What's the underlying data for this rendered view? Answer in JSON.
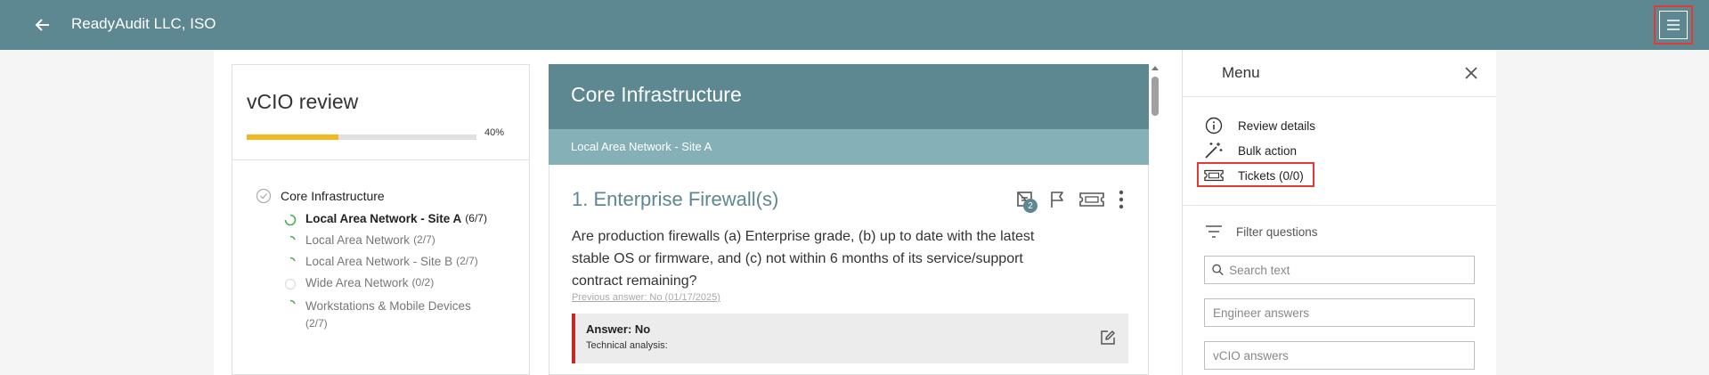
{
  "header": {
    "title": "ReadyAudit LLC, ISO",
    "back_icon": "arrow-left-icon",
    "menu_icon": "hamburger-menu-icon",
    "bar_color": "#5d8791"
  },
  "review": {
    "title": "vCIO review",
    "progress_percent": 40,
    "progress_label": "40%",
    "progress_color": "#f3b81f",
    "section": {
      "label": "Core Infrastructure",
      "items": [
        {
          "label": "Local Area Network - Site A",
          "count": "(6/7)",
          "active": true
        },
        {
          "label": "Local Area Network",
          "count": "(2/7)",
          "active": false
        },
        {
          "label": "Local Area Network - Site B",
          "count": "(2/7)",
          "active": false
        },
        {
          "label": "Wide Area Network",
          "count": "(0/2)",
          "active": false
        },
        {
          "label": "Workstations & Mobile Devices",
          "count": "(2/7)",
          "active": false
        }
      ]
    }
  },
  "main": {
    "category_title": "Core Infrastructure",
    "subcategory_title": "Local Area Network - Site A",
    "question": {
      "title": "1. Enterprise Firewall(s)",
      "text": "Are production firewalls (a) Enterprise grade, (b) up to date with the latest stable OS or firmware, and (c) not within 6 months of its service/support contract remaining?",
      "previous_answer": "Previous answer: No (01/17/2025)",
      "notes_badge": "2",
      "answer_label": "Answer: No",
      "technical_label": "Technical analysis:",
      "answer_color": "#c62828"
    }
  },
  "menu": {
    "title": "Menu",
    "items": [
      {
        "label": "Review details",
        "icon": "info-icon"
      },
      {
        "label": "Bulk action",
        "icon": "magic-wand-icon"
      },
      {
        "label": "Tickets (0/0)",
        "icon": "ticket-icon"
      }
    ],
    "filter_label": "Filter questions",
    "search_placeholder": "Search text",
    "engineer_placeholder": "Engineer answers",
    "vcio_placeholder": "vCIO answers"
  }
}
